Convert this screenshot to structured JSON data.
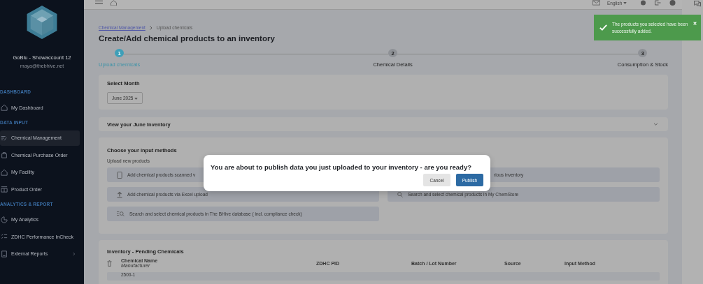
{
  "topbar": {
    "language": "English"
  },
  "sidebar": {
    "account_name": "GoBlu - Showaccount 12",
    "email": "maya@thebhive.net",
    "sections": [
      {
        "title": "DASHBOARD",
        "items": [
          {
            "label": "My Dashboard",
            "selected": false,
            "has_submenu": false
          }
        ]
      },
      {
        "title": "DATA INPUT",
        "items": [
          {
            "label": "Chemical Management",
            "selected": true,
            "has_submenu": false
          },
          {
            "label": "Chemical Purchase Order",
            "selected": false,
            "has_submenu": false
          },
          {
            "label": "My Facility",
            "selected": false,
            "has_submenu": false
          },
          {
            "label": "Product Order",
            "selected": false,
            "has_submenu": false
          }
        ]
      },
      {
        "title": "ANALYTICS & REPORT",
        "items": [
          {
            "label": "My Analytics",
            "selected": false,
            "has_submenu": false
          },
          {
            "label": "ZDHC Performance InCheck",
            "selected": false,
            "has_submenu": false
          },
          {
            "label": "External Reports",
            "selected": false,
            "has_submenu": true
          }
        ]
      }
    ]
  },
  "breadcrumb": [
    {
      "label": "Chemical Management",
      "kind": "link"
    },
    {
      "label": "Upload chemicals",
      "kind": "current"
    }
  ],
  "title": "Create/Add chemical products to an inventory",
  "steps": [
    {
      "number": "1",
      "label": "Upload chemicals",
      "selected": true
    },
    {
      "number": "2",
      "label": "Chemical Details",
      "selected": false
    },
    {
      "number": "3",
      "label": "Consumption & Stock",
      "selected": false
    }
  ],
  "month_card": {
    "title": "Select Month",
    "value": "June 2025"
  },
  "inventory_view": {
    "title": "View your June Inventory",
    "expanded": false
  },
  "input_methods": {
    "title": "Choose your input methods",
    "subtitle": "Upload new products",
    "options": [
      {
        "label": "Add chemical products scanned v"
      },
      {
        "label": "rious inventory"
      },
      {
        "label": "Add chemical products via Excel upload"
      },
      {
        "label": "Search and select chemical products in My ChemStore"
      },
      {
        "label": "Search and select chemical products in The BHive database ( incl. compliance check)"
      }
    ]
  },
  "pending": {
    "title": "Inventory - Pending Chemicals",
    "columns": [
      {
        "label": "Chemical Name",
        "sublabel": "Manufacturer"
      },
      {
        "label": "ZDHC PID"
      },
      {
        "label": "Batch / Lot Number"
      },
      {
        "label": "Source"
      },
      {
        "label": "Input Method"
      }
    ],
    "rows": [
      {
        "column_1": "2500-1"
      }
    ]
  },
  "toast": {
    "kind": "success",
    "message": "The products you selected have been successfully added."
  },
  "modal": {
    "message": "You are about to publish data you just uploaded to your inventory - are you ready?",
    "buttons": [
      {
        "label": "Cancel",
        "kind": "secondary"
      },
      {
        "label": "Publish",
        "kind": "primary"
      }
    ]
  }
}
